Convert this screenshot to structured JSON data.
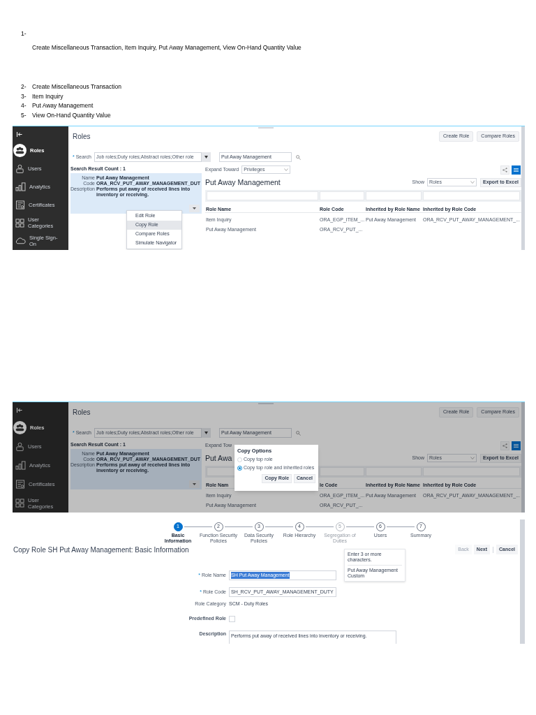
{
  "notes": {
    "heading": "1-",
    "line": "Create Miscellaneous Transaction, Item Inquiry, Put Away Management, View On-Hand Quantity Value",
    "list": [
      {
        "number": "2-",
        "text": "Create Miscellaneous Transaction"
      },
      {
        "number": "3-",
        "text": "Item Inquiry"
      },
      {
        "number": "4-",
        "text": "Put Away Management"
      },
      {
        "number": "5-",
        "text": "View On-Hand Quantity Value"
      }
    ]
  },
  "screens": [
    {
      "sidebar": [
        {
          "label": "Roles",
          "selected": true
        },
        {
          "label": "Users",
          "selected": false
        },
        {
          "label": "Analytics",
          "selected": false
        },
        {
          "label": "Certificates",
          "selected": false
        },
        {
          "label": "User Categories",
          "selected": false
        },
        {
          "label": "Single Sign-On",
          "selected": false
        }
      ],
      "title": "Roles",
      "buttons": [
        "Create Role",
        "Compare Roles"
      ],
      "search_mark": "*",
      "search_label": "Search",
      "search_scope": "Job roles;Duty roles;Abstract roles;Other role",
      "keyword": "Put Away Management",
      "result_count": "Search Result Count : 1",
      "result": [
        {
          "label": "Name",
          "value": "Put Away Management"
        },
        {
          "label": "Code",
          "value": "ORA_RCV_PUT_AWAY_MANAGEMENT_DUT"
        },
        {
          "label": "Description",
          "value": "Performs put away of received lines into inventory or receiving."
        }
      ],
      "expand_label": "Expand Toward",
      "expand_value": "Privileges",
      "heading": "Put Away Management",
      "show_label": "Show",
      "show_value": "Roles",
      "export_button": "Export to Excel",
      "table": {
        "columns": [
          "Role Name",
          "Role Code",
          "Inherited by Role Name",
          "Inherited by Role Code"
        ],
        "rows": [
          [
            "Item Inquiry",
            "ORA_EGP_ITEM_...",
            "Put Away Management",
            "ORA_RCV_PUT_AWAY_MANAGEMENT_..."
          ],
          [
            "Put Away Management",
            "ORA_RCV_PUT_..."
          ]
        ]
      },
      "menu": [
        {
          "label": "Edit Role",
          "selected": false
        },
        {
          "label": "Copy Role",
          "selected": true
        },
        {
          "label": "Compare Roles",
          "selected": false
        },
        {
          "label": "Simulate Navigator",
          "selected": false
        }
      ]
    },
    {
      "sidebar": [
        {
          "label": "Roles",
          "selected": true
        },
        {
          "label": "Users",
          "selected": false
        },
        {
          "label": "Analytics",
          "selected": false
        },
        {
          "label": "Certificates",
          "selected": false
        },
        {
          "label": "User Categories",
          "selected": false
        }
      ],
      "title": "Roles",
      "buttons": [
        "Create Role",
        "Compare Roles"
      ],
      "search_mark": "*",
      "search_label": "Search",
      "search_scope": "Job roles;Duty roles;Abstract roles;Other role",
      "keyword": "Put Away Management",
      "result_count": "Search Result Count : 1",
      "result": [
        {
          "label": "Name",
          "value": "Put Away Management"
        },
        {
          "label": "Code",
          "value": "ORA_RCV_PUT_AWAY_MANAGEMENT_DUT"
        },
        {
          "label": "Description",
          "value": "Performs put away of received lines into inventory or receiving."
        }
      ],
      "expand_label": "Expand Tow",
      "heading": "Put Awa",
      "show_label": "Show",
      "show_value": "Roles",
      "export_button": "Export to Excel",
      "table": {
        "columns": [
          "Role Nam",
          "le Code",
          "Inherited by Role Name",
          "Inherited by Role Code"
        ],
        "rows": [
          [
            "Item Inquiry",
            "ORA_EGP_ITEM_...",
            "Put Away Management",
            "ORA_RCV_PUT_AWAY_MANAGEMENT_..."
          ],
          [
            "Put Away Management",
            "ORA_RCV_PUT_..."
          ]
        ]
      },
      "dialog": {
        "title": "Copy Options",
        "options": [
          {
            "label": "Copy top role",
            "selected": false
          },
          {
            "label": "Copy top role and inherited roles",
            "selected": true
          }
        ],
        "buttons": [
          "Copy Role",
          "Cancel"
        ]
      }
    }
  ],
  "wizard": {
    "steps": [
      {
        "number": "1",
        "label": "Basic Information",
        "selected": true,
        "disabled": false
      },
      {
        "number": "2",
        "label": "Function Security Policies",
        "selected": false,
        "disabled": false
      },
      {
        "number": "3",
        "label": "Data Security Policies",
        "selected": false,
        "disabled": false
      },
      {
        "number": "4",
        "label": "Role Hierarchy",
        "selected": false,
        "disabled": false
      },
      {
        "number": "5",
        "label": "Segregation of Duties",
        "selected": false,
        "disabled": true
      },
      {
        "number": "6",
        "label": "Users",
        "selected": false,
        "disabled": false
      },
      {
        "number": "7",
        "label": "Summary",
        "selected": false,
        "disabled": false
      }
    ],
    "title": "Copy Role SH Put Away Management: Basic Information",
    "buttons": [
      {
        "label": "Back",
        "disabled": true
      },
      {
        "label": "Next",
        "disabled": false
      },
      {
        "label": "Cancel",
        "disabled": false
      }
    ],
    "fields": [
      {
        "kind": "text",
        "mark": "*",
        "label": "Role Name",
        "value": "SH Put Away Management",
        "highlighted": true
      },
      {
        "kind": "text",
        "mark": "*",
        "label": "Role Code",
        "value": "SH_RCV_PUT_AWAY_MANAGEMENT_DUTY",
        "highlighted": false
      },
      {
        "kind": "static",
        "label": "Role Category",
        "value": "SCM - Duty Roles"
      },
      {
        "kind": "checkbox",
        "label": "Predefined Role",
        "checked": false
      },
      {
        "kind": "textarea",
        "label": "Description",
        "value": "Performs put away of received lines into inventory or receiving."
      }
    ],
    "tooltip": [
      "Enter 3 or more characters.",
      "Put Away Management Custom"
    ]
  }
}
